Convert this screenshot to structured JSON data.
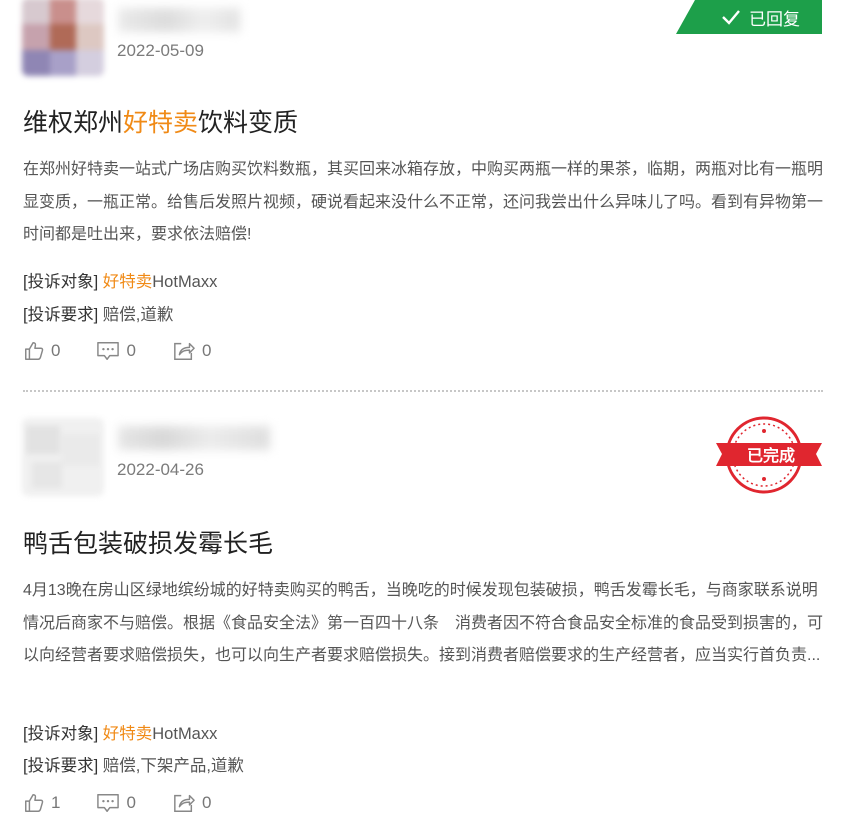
{
  "colors": {
    "accent_orange": "#f08a16",
    "replied_green": "#1d9f4a",
    "stamp_red": "#e0262f"
  },
  "complaints": [
    {
      "date": "2022-05-09",
      "status_label": "已回复",
      "title_prefix": "维权郑州",
      "title_highlight": "好特卖",
      "title_suffix": "饮料变质",
      "description": "在郑州好特卖一站式广场店购买饮料数瓶，其买回来冰箱存放，中购买两瓶一样的果茶，临期，两瓶对比有一瓶明显变质，一瓶正常。给售后发照片视频，硬说看起来没什么不正常，还问我尝出什么异味儿了吗。看到有异物第一时间都是吐出来，要求依法赔偿!",
      "target_tag": "[投诉对象]",
      "target_cn": "好特卖",
      "target_en": "HotMaxx",
      "request_tag": "[投诉要求]",
      "request": "赔偿,道歉",
      "likes": "0",
      "comments": "0",
      "shares": "0"
    },
    {
      "date": "2022-04-26",
      "status_label": "已完成",
      "title": "鸭舌包装破损发霉长毛",
      "description": "4月13晚在房山区绿地缤纷城的好特卖购买的鸭舌，当晚吃的时候发现包装破损，鸭舌发霉长毛，与商家联系说明情况后商家不与赔偿。根据《食品安全法》第一百四十八条　消费者因不符合食品安全标准的食品受到损害的，可以向经营者要求赔偿损失，也可以向生产者要求赔偿损失。接到消费者赔偿要求的生产经营者，应当实行首负责...",
      "target_tag": "[投诉对象]",
      "target_cn": "好特卖",
      "target_en": "HotMaxx",
      "request_tag": "[投诉要求]",
      "request": "赔偿,下架产品,道歉",
      "likes": "1",
      "comments": "0",
      "shares": "0"
    }
  ]
}
